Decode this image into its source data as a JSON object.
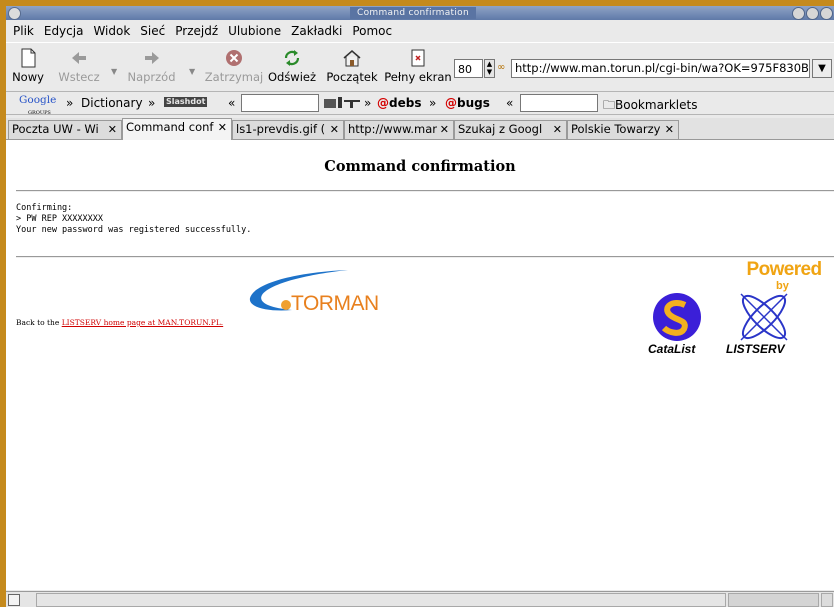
{
  "window": {
    "title": "Command confirmation"
  },
  "menu": [
    "Plik",
    "Edycja",
    "Widok",
    "Sieć",
    "Przejdź",
    "Ulubione",
    "Zakładki",
    "Pomoc"
  ],
  "toolbar": {
    "new": "Nowy",
    "back": "Wstecz",
    "forward": "Naprzód",
    "stop": "Zatrzymaj",
    "reload": "Odśwież",
    "home": "Początek",
    "fullscreen": "Pełny ekran",
    "zoom": "80",
    "url": "http://www.man.torun.pl/cgi-bin/wa?OK=975F830B"
  },
  "bookmarks": {
    "google_logo": "Google",
    "google_sub": "GROUPS",
    "dictionary": "Dictionary",
    "slashdot": "Slashdot",
    "debs": "debs",
    "bugs": "bugs",
    "bookmarklets": "Bookmarklets"
  },
  "tabs": [
    {
      "label": "Poczta UW - Wi"
    },
    {
      "label": "Command conf"
    },
    {
      "label": "ls1-prevdis.gif ("
    },
    {
      "label": "http://www.mar"
    },
    {
      "label": "Szukaj z Googl"
    },
    {
      "label": "Polskie Towarzy"
    }
  ],
  "page": {
    "title": "Command confirmation",
    "confirm_lines": "Confirming:\n> PW REP XXXXXXXX\nYour new password was registered successfully.",
    "back_prefix": "Back to the ",
    "back_link": "LISTSERV home page at MAN.TORUN.PL.",
    "torman": "TORMAN",
    "powered": "Powered",
    "by": "by",
    "catalist": "CataList",
    "listserv": "LISTSERV"
  },
  "status": {
    "text": ""
  },
  "colors": {
    "desktop": "#c58a1d",
    "titlebar": "#6f87b4",
    "link": "#d00000",
    "powered": "#f0a413"
  }
}
